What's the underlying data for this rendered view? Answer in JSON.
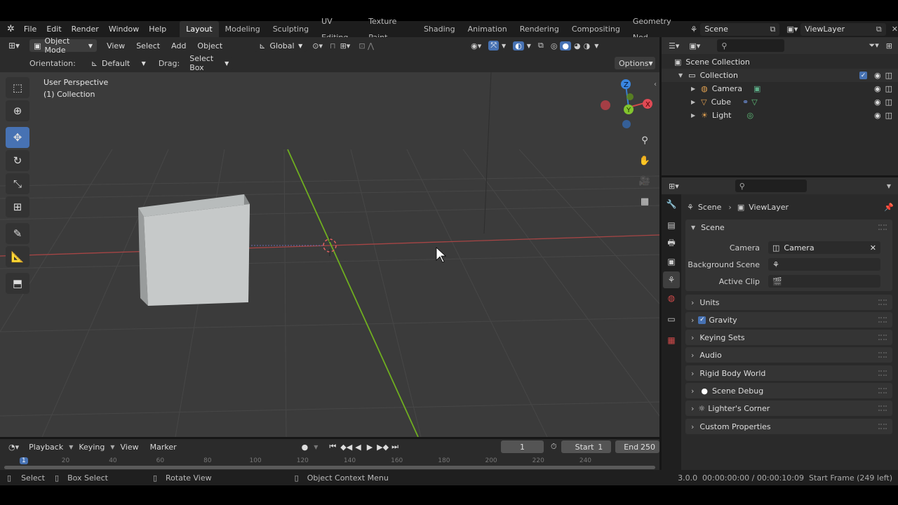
{
  "menubar": {
    "menus": [
      "File",
      "Edit",
      "Render",
      "Window",
      "Help"
    ],
    "workspaces": [
      "Layout",
      "Modeling",
      "Sculpting",
      "UV Editing",
      "Texture Paint",
      "Shading",
      "Animation",
      "Rendering",
      "Compositing",
      "Geometry Nod"
    ],
    "active_workspace": "Layout",
    "scene": "Scene",
    "view_layer": "ViewLayer"
  },
  "viewport": {
    "mode": "Object Mode",
    "menus": [
      "View",
      "Select",
      "Add",
      "Object"
    ],
    "transform_orientation": "Global",
    "orientation_label": "Orientation:",
    "orientation_value": "Default",
    "drag_label": "Drag:",
    "drag_value": "Select Box",
    "options_label": "Options",
    "overlay_line1": "User Perspective",
    "overlay_line2": "(1) Collection",
    "gizmo_axes": [
      "X",
      "Y",
      "Z"
    ]
  },
  "timeline": {
    "menus": [
      "Playback",
      "Keying",
      "View",
      "Marker"
    ],
    "current_frame": "1",
    "start_label": "Start",
    "start_value": "1",
    "end_label": "End",
    "end_value": "250",
    "ruler_ticks": [
      "1",
      "20",
      "40",
      "60",
      "80",
      "100",
      "120",
      "140",
      "160",
      "180",
      "200",
      "220",
      "240"
    ]
  },
  "statusbar": {
    "select": "Select",
    "box_select": "Box Select",
    "rotate_view": "Rotate View",
    "context_menu": "Object Context Menu",
    "info": "3.0.0  00:00:00:00 / 00:00:10:09  Start Frame (249 left)"
  },
  "outliner": {
    "root": "Scene Collection",
    "collection": "Collection",
    "items": [
      {
        "label": "Camera",
        "icon_color": "#e0a050"
      },
      {
        "label": "Cube",
        "icon_color": "#e0a050"
      },
      {
        "label": "Light",
        "icon_color": "#e0a050"
      }
    ]
  },
  "properties": {
    "breadcrumb_scene": "Scene",
    "breadcrumb_viewlayer": "ViewLayer",
    "scene_panel": "Scene",
    "camera_label": "Camera",
    "camera_value": "Camera",
    "background_scene_label": "Background Scene",
    "active_clip_label": "Active Clip",
    "panels": [
      "Units",
      "Gravity",
      "Keying Sets",
      "Audio",
      "Rigid Body World",
      "Scene Debug",
      "Lighter's Corner",
      "Custom Properties"
    ]
  },
  "colors": {
    "accent": "#4772b3",
    "x_axis": "#d04a4a",
    "y_axis": "#7fbf2a",
    "z_axis": "#3a7fd0"
  }
}
